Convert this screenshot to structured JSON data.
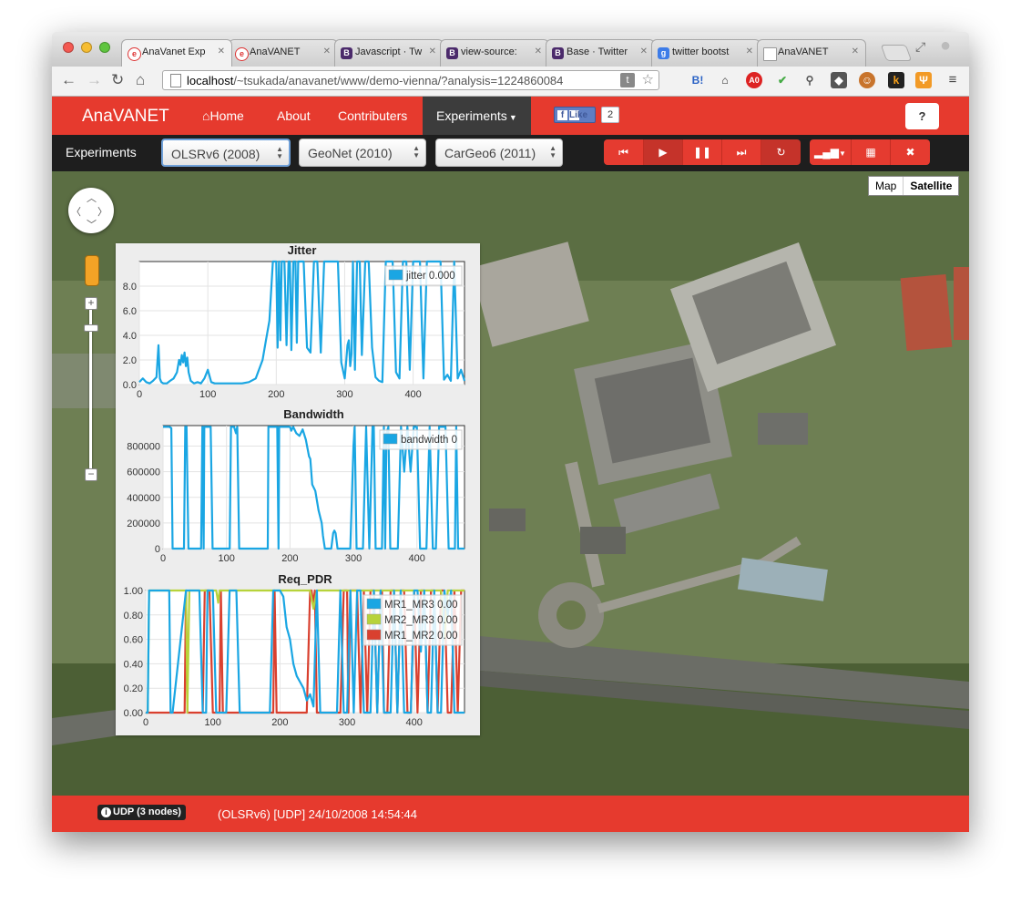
{
  "browser": {
    "tabs": [
      {
        "label": "AnaVanet Exp",
        "icon": "anavanet-favicon",
        "active": true
      },
      {
        "label": "AnaVANET",
        "icon": "anavanet-favicon",
        "active": false
      },
      {
        "label": "Javascript · Tw",
        "icon": "bootstrap-favicon",
        "active": false
      },
      {
        "label": "view-source:",
        "icon": "bootstrap-favicon",
        "active": false
      },
      {
        "label": "Base · Twitter",
        "icon": "bootstrap-favicon",
        "active": false
      },
      {
        "label": "twitter bootst",
        "icon": "google-favicon",
        "active": false
      },
      {
        "label": "AnaVANET",
        "icon": "page-icon",
        "active": false
      }
    ],
    "url_host": "localhost",
    "url_path": "/~tsukada/anavanet/www/demo-vienna/?analysis=1224860084",
    "extensions": [
      "twitter-icon",
      "star-icon",
      "hatena-bookmark-icon",
      "museum-icon",
      "adblock-icon",
      "check-icon",
      "broom-icon",
      "evernote-icon",
      "monkey-icon",
      "klout-icon",
      "fork-icon",
      "menu-icon"
    ]
  },
  "navbar": {
    "brand": "AnaVANET",
    "items": [
      "Home",
      "About",
      "Contributers",
      "Experiments"
    ],
    "fb_like": "Like",
    "fb_count": "2",
    "help": "?"
  },
  "subbar": {
    "label": "Experiments",
    "selects": [
      "OLSRv6 (2008)",
      "GeoNet (2010)",
      "CarGeo6 (2011)"
    ],
    "controls": [
      "step-back-icon",
      "play-icon",
      "pause-icon",
      "step-forward-icon",
      "refresh-icon",
      "signal-icon",
      "grid-icon",
      "close-icon"
    ]
  },
  "map": {
    "types": [
      "Map",
      "Satellite"
    ],
    "selected": "Satellite"
  },
  "charts": [
    {
      "type": "line",
      "title": "Jitter",
      "xticks": [
        "0",
        "100",
        "200",
        "300",
        "400"
      ],
      "yticks": [
        "0.0",
        "2.0",
        "4.0",
        "6.0",
        "8.0"
      ],
      "xlim": [
        0,
        475
      ],
      "ylim": [
        0,
        10
      ],
      "legend": [
        "jitter 0.000"
      ],
      "colors": [
        "#1aa6e3"
      ],
      "series": [
        {
          "name": "jitter 0.000",
          "x": [
            0,
            5,
            10,
            15,
            20,
            25,
            28,
            30,
            32,
            35,
            40,
            45,
            50,
            55,
            58,
            60,
            62,
            64,
            66,
            68,
            70,
            72,
            75,
            80,
            85,
            90,
            95,
            100,
            105,
            110,
            115,
            120,
            125,
            130,
            135,
            140,
            150,
            160,
            170,
            180,
            185,
            190,
            195,
            200,
            202,
            204,
            206,
            208,
            210,
            212,
            215,
            218,
            220,
            222,
            225,
            228,
            230,
            232,
            236,
            240,
            245,
            250,
            255,
            260,
            265,
            270,
            275,
            280,
            285,
            290,
            295,
            300,
            302,
            304,
            306,
            308,
            310,
            312,
            315,
            318,
            320,
            322,
            325,
            330,
            335,
            340,
            345,
            350,
            355,
            360,
            365,
            370,
            375,
            380,
            385,
            390,
            395,
            400,
            405,
            410,
            415,
            420,
            425,
            430,
            435,
            440,
            445,
            450,
            455,
            460,
            465,
            470,
            475
          ],
          "y": [
            0.2,
            0.5,
            0.2,
            0.1,
            0.3,
            0.6,
            3.2,
            0.5,
            0.2,
            0.1,
            0.1,
            0.3,
            0.5,
            1.0,
            2.0,
            1.6,
            2.4,
            1.8,
            2.6,
            1.5,
            2.2,
            1.0,
            0.3,
            0.1,
            0.2,
            0.1,
            0.5,
            1.2,
            0.2,
            0.1,
            0.1,
            0.1,
            0.1,
            0.1,
            0.1,
            0.1,
            0.1,
            0.2,
            0.5,
            2.0,
            3.6,
            5.2,
            10,
            10,
            3.0,
            10,
            3.6,
            10,
            10,
            10,
            3.2,
            10,
            10,
            2.8,
            10,
            10,
            3.4,
            10,
            10,
            10,
            3.0,
            2.6,
            10,
            10,
            2.6,
            10,
            10,
            10,
            10,
            10,
            1.8,
            0.5,
            1.8,
            3.2,
            3.6,
            1.5,
            2.5,
            10,
            1.2,
            10,
            10,
            10,
            2.4,
            10,
            10,
            3.0,
            0.6,
            0.3,
            0.2,
            10,
            10,
            10,
            1.0,
            0.5,
            10,
            10,
            1.2,
            10,
            10,
            10,
            0.5,
            10,
            10,
            10,
            10,
            10,
            0.4,
            0.8,
            0.3,
            10,
            0.5,
            1.2,
            0.3
          ]
        }
      ]
    },
    {
      "type": "line",
      "title": "Bandwidth",
      "xticks": [
        "0",
        "100",
        "200",
        "300",
        "400"
      ],
      "yticks": [
        "0",
        "200000",
        "400000",
        "600000",
        "800000"
      ],
      "xlim": [
        0,
        475
      ],
      "ylim": [
        0,
        960000
      ],
      "legend": [
        "bandwidth 0"
      ],
      "colors": [
        "#1aa6e3"
      ],
      "series": [
        {
          "name": "bandwidth 0",
          "x": [
            0,
            5,
            10,
            13,
            15,
            33,
            35,
            37,
            40,
            60,
            62,
            64,
            65,
            66,
            68,
            70,
            72,
            75,
            78,
            80,
            82,
            105,
            107,
            110,
            112,
            115,
            117,
            120,
            130,
            140,
            165,
            166,
            170,
            172,
            175,
            178,
            180,
            182,
            183,
            200,
            202,
            205,
            210,
            215,
            220,
            225,
            230,
            232,
            235,
            240,
            245,
            250,
            252,
            255,
            258,
            260,
            265,
            268,
            270,
            272,
            275,
            278,
            280,
            285,
            290,
            295,
            300,
            302,
            305,
            310,
            315,
            320,
            325,
            330,
            332,
            335,
            340,
            345,
            348,
            350,
            352,
            355,
            358,
            360,
            365,
            370,
            375,
            380,
            385,
            390,
            395,
            400,
            405,
            410,
            415,
            420,
            425,
            430,
            435,
            440,
            445,
            450,
            455,
            460,
            462,
            465,
            470,
            475
          ],
          "y": [
            950000,
            950000,
            950000,
            940000,
            0,
            0,
            950000,
            950000,
            0,
            0,
            950000,
            0,
            950000,
            950000,
            950000,
            950000,
            950000,
            950000,
            0,
            0,
            0,
            0,
            950000,
            950000,
            950000,
            900000,
            950000,
            0,
            0,
            0,
            0,
            950000,
            950000,
            950000,
            950000,
            950000,
            950000,
            0,
            950000,
            950000,
            920000,
            950000,
            900000,
            880000,
            930000,
            850000,
            720000,
            700000,
            500000,
            450000,
            300000,
            200000,
            100000,
            0,
            0,
            0,
            0,
            120000,
            140000,
            120000,
            0,
            0,
            0,
            0,
            0,
            0,
            800000,
            950000,
            0,
            0,
            0,
            950000,
            0,
            950000,
            950000,
            0,
            0,
            0,
            950000,
            0,
            900000,
            950000,
            0,
            0,
            0,
            0,
            950000,
            600000,
            950000,
            600000,
            950000,
            950000,
            0,
            0,
            0,
            950000,
            0,
            0,
            950000,
            950000,
            950000,
            0,
            0,
            0,
            950000,
            0,
            0,
            0
          ]
        }
      ]
    },
    {
      "type": "line",
      "title": "Req_PDR",
      "xticks": [
        "0",
        "100",
        "200",
        "300",
        "400"
      ],
      "yticks": [
        "0.00",
        "0.20",
        "0.40",
        "0.60",
        "0.80",
        "1.00"
      ],
      "xlim": [
        0,
        475
      ],
      "ylim": [
        0,
        1.0
      ],
      "legend": [
        "MR1_MR3 0.00",
        "MR2_MR3 0.00",
        "MR1_MR2 0.00"
      ],
      "colors": [
        "#1aa6e3",
        "#b7d33b",
        "#d9402f"
      ],
      "series": [
        {
          "name": "MR1_MR3 0.00",
          "x": [
            0,
            3,
            5,
            35,
            37,
            40,
            60,
            62,
            70,
            75,
            80,
            85,
            90,
            92,
            95,
            100,
            105,
            110,
            115,
            120,
            125,
            130,
            135,
            140,
            150,
            160,
            170,
            180,
            185,
            190,
            195,
            200,
            205,
            210,
            215,
            220,
            225,
            230,
            235,
            240,
            245,
            250,
            255,
            260,
            265,
            270,
            275,
            280,
            285,
            290,
            295,
            300,
            305,
            310,
            315,
            320,
            325,
            330,
            335,
            340,
            345,
            350,
            355,
            360,
            365,
            370,
            375,
            380,
            385,
            390,
            395,
            400,
            405,
            410,
            415,
            420,
            425,
            430,
            435,
            440,
            445,
            450,
            455,
            460,
            465,
            470,
            475
          ],
          "y": [
            0,
            0,
            1.0,
            1.0,
            0,
            0,
            1.0,
            1.0,
            1.0,
            1.0,
            1.0,
            0,
            0,
            1.0,
            1.0,
            1.0,
            0,
            0,
            0,
            0,
            1.0,
            1.0,
            1.0,
            0,
            0,
            0,
            0,
            0,
            0,
            1.0,
            1.0,
            1.0,
            0.95,
            0.7,
            0.6,
            0.4,
            0.3,
            0.25,
            0.2,
            0.1,
            0.15,
            0.05,
            1.0,
            0,
            0,
            0,
            0,
            0,
            0,
            1.0,
            0,
            0,
            1.0,
            0,
            1.0,
            1.0,
            0,
            0,
            0,
            1.0,
            0,
            1.0,
            0,
            0,
            0,
            1.0,
            0,
            1.0,
            0,
            0,
            0,
            1.0,
            1.0,
            0.5,
            1.0,
            0,
            0,
            1.0,
            0,
            0,
            1.0,
            0.8,
            1.0,
            0,
            0,
            0,
            0
          ]
        },
        {
          "name": "MR2_MR3 0.00",
          "x": [
            0,
            3,
            5,
            40,
            45,
            50,
            55,
            60,
            62,
            65,
            70,
            75,
            80,
            85,
            90,
            95,
            100,
            105,
            108,
            110,
            115,
            120,
            125,
            130,
            135,
            140,
            145,
            150,
            155,
            160,
            165,
            170,
            175,
            180,
            185,
            190,
            195,
            200,
            205,
            210,
            215,
            220,
            225,
            230,
            235,
            240,
            245,
            250,
            255,
            260,
            265,
            270,
            275,
            280,
            285,
            290,
            295,
            300,
            305,
            310,
            315,
            320,
            325,
            330,
            335,
            340,
            345,
            350,
            355,
            360,
            365,
            370,
            375,
            380,
            385,
            390,
            395,
            400,
            405,
            410,
            415,
            420,
            425,
            430,
            435,
            440,
            445,
            450,
            455,
            460,
            465,
            470,
            475
          ],
          "y": [
            0,
            0,
            1.0,
            1.0,
            1.0,
            1.0,
            1.0,
            1.0,
            0,
            1.0,
            1.0,
            1.0,
            1.0,
            1.0,
            1.0,
            1.0,
            1.0,
            1.0,
            0.9,
            1.0,
            1.0,
            1.0,
            1.0,
            1.0,
            1.0,
            1.0,
            1.0,
            1.0,
            1.0,
            1.0,
            1.0,
            1.0,
            1.0,
            1.0,
            1.0,
            1.0,
            1.0,
            1.0,
            1.0,
            1.0,
            1.0,
            1.0,
            1.0,
            1.0,
            1.0,
            1.0,
            1.0,
            0.85,
            1.0,
            1.0,
            1.0,
            1.0,
            1.0,
            1.0,
            1.0,
            1.0,
            1.0,
            1.0,
            1.0,
            1.0,
            1.0,
            1.0,
            1.0,
            1.0,
            1.0,
            1.0,
            1.0,
            1.0,
            1.0,
            1.0,
            1.0,
            1.0,
            1.0,
            1.0,
            1.0,
            1.0,
            1.0,
            1.0,
            1.0,
            1.0,
            1.0,
            1.0,
            1.0,
            1.0,
            1.0,
            1.0,
            0.6,
            1.0,
            1.0,
            1.0,
            1.0,
            1.0,
            1.0
          ]
        },
        {
          "name": "MR1_MR2 0.00",
          "x": [
            0,
            3,
            5,
            58,
            60,
            62,
            65,
            75,
            85,
            88,
            90,
            95,
            100,
            105,
            110,
            112,
            115,
            125,
            135,
            155,
            175,
            185,
            190,
            192,
            195,
            225,
            240,
            245,
            247,
            250,
            252,
            255,
            258,
            260,
            265,
            285,
            290,
            295,
            300,
            302,
            305,
            315,
            320,
            325,
            330,
            335,
            340,
            345,
            350,
            352,
            355,
            360,
            365,
            370,
            375,
            380,
            385,
            390,
            395,
            400,
            405,
            410,
            415,
            420,
            425,
            430,
            435,
            440,
            445,
            450,
            455,
            460,
            465,
            470,
            475
          ],
          "y": [
            0,
            0,
            0,
            0,
            1.0,
            0,
            0,
            0,
            0,
            1.0,
            1.0,
            1.0,
            0,
            0,
            0,
            1.0,
            0,
            0,
            0,
            0,
            0,
            0,
            0,
            1.0,
            0,
            0,
            0,
            1.0,
            1.0,
            0.9,
            1.0,
            0,
            0,
            0,
            0,
            0,
            0,
            1.0,
            1.0,
            0,
            1.0,
            1.0,
            0,
            1.0,
            0,
            1.0,
            1.0,
            0,
            1.0,
            1.0,
            0,
            0,
            1.0,
            1.0,
            0,
            1.0,
            1.0,
            0,
            0,
            1.0,
            0,
            1.0,
            1.0,
            0,
            1.0,
            1.0,
            0,
            1.0,
            1.0,
            0,
            0,
            1.0,
            0,
            1.0,
            1.0
          ]
        }
      ]
    }
  ],
  "status": {
    "badge": "UDP (3 nodes)",
    "text": "(OLSRv6) [UDP] 24/10/2008 14:54:44"
  }
}
